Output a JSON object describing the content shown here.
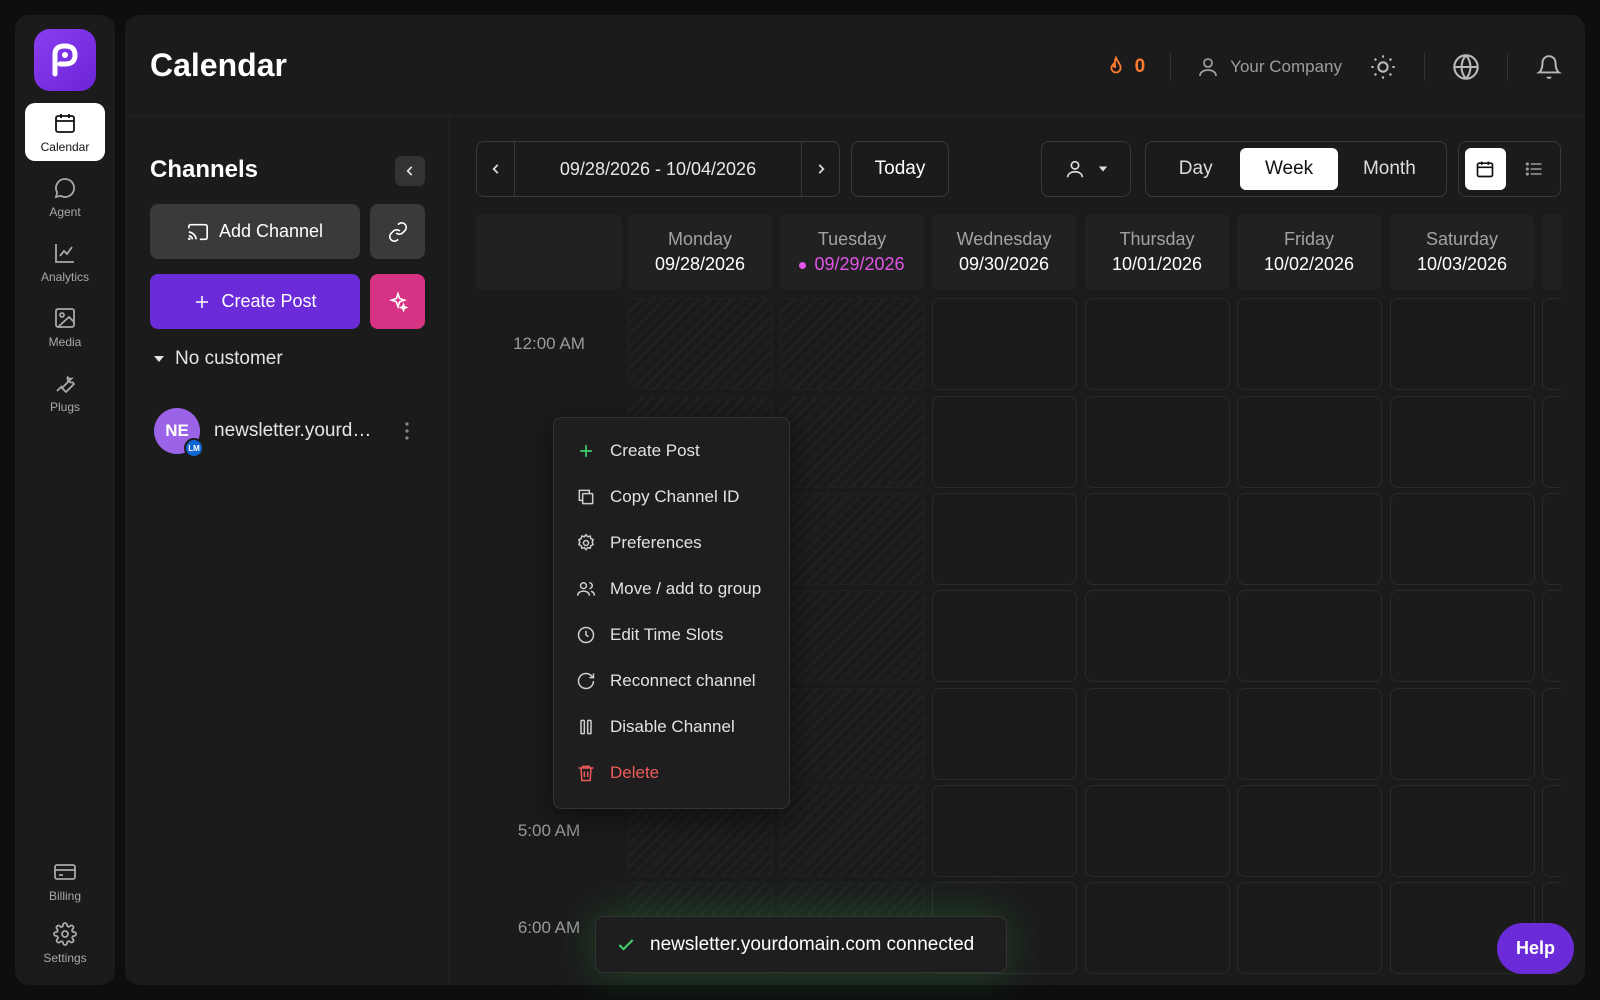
{
  "nav": {
    "items": [
      {
        "label": "Calendar",
        "icon": "calendar-icon",
        "active": true
      },
      {
        "label": "Agent",
        "icon": "chat-bubble-icon"
      },
      {
        "label": "Analytics",
        "icon": "line-chart-icon"
      },
      {
        "label": "Media",
        "icon": "image-icon"
      },
      {
        "label": "Plugs",
        "icon": "wrench-icon"
      }
    ],
    "bottom": [
      {
        "label": "Billing",
        "icon": "credit-card-icon"
      },
      {
        "label": "Settings",
        "icon": "gear-icon"
      }
    ]
  },
  "header": {
    "title": "Calendar",
    "streak_count": "0",
    "company": "Your Company"
  },
  "channels": {
    "title": "Channels",
    "add_channel_label": "Add Channel",
    "create_post_label": "Create Post",
    "group_label": "No customer",
    "channel": {
      "initials": "NE",
      "badge": "LM",
      "name": "newsletter.yourdomain.com"
    }
  },
  "toolbar": {
    "date_range": "09/28/2026 - 10/04/2026",
    "today_label": "Today",
    "views": [
      "Day",
      "Week",
      "Month"
    ],
    "selected_view": "Week"
  },
  "calendar": {
    "days": [
      {
        "name": "Monday",
        "date": "09/28/2026"
      },
      {
        "name": "Tuesday",
        "date": "09/29/2026",
        "today": true
      },
      {
        "name": "Wednesday",
        "date": "09/30/2026"
      },
      {
        "name": "Thursday",
        "date": "10/01/2026"
      },
      {
        "name": "Friday",
        "date": "10/02/2026"
      },
      {
        "name": "Saturday",
        "date": "10/03/2026"
      }
    ],
    "times": [
      "12:00 AM",
      "5:00 AM",
      "6:00 AM"
    ]
  },
  "context_menu": {
    "items": [
      {
        "label": "Create Post",
        "icon": "plus-icon"
      },
      {
        "label": "Copy Channel ID",
        "icon": "copy-icon"
      },
      {
        "label": "Preferences",
        "icon": "gear-icon"
      },
      {
        "label": "Move / add to group",
        "icon": "users-icon"
      },
      {
        "label": "Edit Time Slots",
        "icon": "clock-icon"
      },
      {
        "label": "Reconnect channel",
        "icon": "refresh-icon"
      },
      {
        "label": "Disable Channel",
        "icon": "pause-icon"
      },
      {
        "label": "Delete",
        "icon": "trash-icon",
        "danger": true
      }
    ]
  },
  "toast": {
    "message": "newsletter.yourdomain.com connected"
  },
  "help_label": "Help",
  "colors": {
    "accent": "#6c2bd9",
    "magic": "#d63384",
    "today": "#e255e8",
    "streak": "#ff7a2f",
    "success": "#3fcf6f",
    "danger": "#ef5a5a"
  }
}
